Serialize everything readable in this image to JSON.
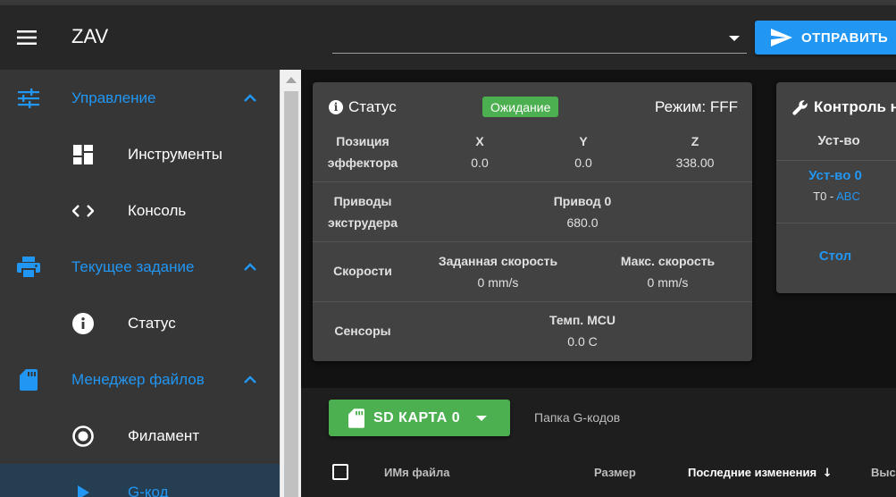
{
  "header": {
    "title": "ZAV",
    "send_label": "ОТПРАВИТЬ",
    "command_value": ""
  },
  "sidebar": {
    "items": [
      {
        "label": "Управление",
        "type": "group"
      },
      {
        "label": "Инструменты",
        "type": "sub"
      },
      {
        "label": "Консоль",
        "type": "sub"
      },
      {
        "label": "Текущее задание",
        "type": "group"
      },
      {
        "label": "Статус",
        "type": "sub"
      },
      {
        "label": "Менеджер файлов",
        "type": "group"
      },
      {
        "label": "Филамент",
        "type": "sub"
      },
      {
        "label": "G-код",
        "type": "sub",
        "active": true
      }
    ]
  },
  "status": {
    "title": "Статус",
    "state": "Ожидание",
    "mode": "Режим: FFF",
    "position": {
      "label_line1": "Позиция",
      "label_line2": "эффектора",
      "axes": [
        {
          "name": "X",
          "value": "0.0"
        },
        {
          "name": "Y",
          "value": "0.0"
        },
        {
          "name": "Z",
          "value": "338.00"
        }
      ]
    },
    "extruders": {
      "label_line1": "Приводы",
      "label_line2": "экструдера",
      "drive_name": "Привод 0",
      "drive_value": "680.0"
    },
    "speeds": {
      "label": "Скорости",
      "requested_label": "Заданная скорость",
      "requested_value": "0 mm/s",
      "max_label": "Макс. скорость",
      "max_value": "0 mm/s"
    },
    "sensors": {
      "label": "Сенсоры",
      "mcu_label": "Темп. MCU",
      "mcu_value": "0.0 C"
    }
  },
  "control": {
    "title": "Контроль н",
    "column_label": "Уст-во",
    "tool_name": "Уст-во 0",
    "tool_sub_prefix": "T0 - ",
    "tool_sub_link": "ABC",
    "bed_label": "Стол"
  },
  "files": {
    "sd_label": "SD КАРТА 0",
    "folder": "Папка G-кодов",
    "columns": [
      "ИМя файла",
      "Размер",
      "Последние изменения",
      "Выс"
    ],
    "sort_arrow": "↓"
  },
  "colors": {
    "accent": "#2196f3",
    "success": "#4caf50",
    "card": "#424242",
    "sidebar": "#363636"
  }
}
